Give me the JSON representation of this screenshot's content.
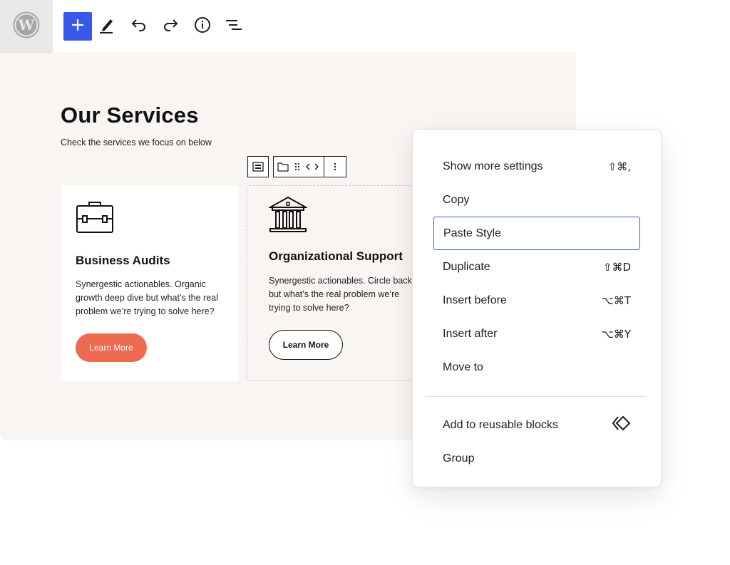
{
  "toolbar": {
    "logo_icon": "wordpress-logo-icon",
    "buttons": [
      {
        "name": "add-block",
        "icon": "plus-icon"
      },
      {
        "name": "tools",
        "icon": "pencil-icon"
      },
      {
        "name": "undo",
        "icon": "undo-icon"
      },
      {
        "name": "redo",
        "icon": "redo-icon"
      },
      {
        "name": "details",
        "icon": "info-icon"
      },
      {
        "name": "list-view",
        "icon": "list-view-icon"
      }
    ],
    "accent": "#3858e9"
  },
  "page": {
    "title": "Our Services",
    "subtitle": "Check the services we focus on below"
  },
  "block_toolbar": {
    "icons": [
      "block-type-icon",
      "folder-icon",
      "drag-handle-icon",
      "move-arrows-icon",
      "more-options-icon"
    ]
  },
  "cards": [
    {
      "icon": "briefcase-icon",
      "title": "Business Audits",
      "text": "Synergestic actionables. Organic growth deep dive but what’s the real problem we’re trying to solve here?",
      "button": "Learn More",
      "button_color": "#ee6a50"
    },
    {
      "icon": "bank-building-icon",
      "title": "Organizational Support",
      "text": "Synergestic actionables. Circle back but what’s the real problem we’re trying to solve here?",
      "button": "Learn More"
    }
  ],
  "menu": {
    "items": [
      {
        "label": "Show more settings",
        "shortcut": "⇧⌘,"
      },
      {
        "label": "Copy",
        "shortcut": ""
      },
      {
        "label": "Paste Style",
        "shortcut": "",
        "active": true
      },
      {
        "label": "Duplicate",
        "shortcut": "⇧⌘D"
      },
      {
        "label": "Insert before",
        "shortcut": "⌥⌘T"
      },
      {
        "label": "Insert after",
        "shortcut": "⌥⌘Y"
      },
      {
        "label": "Move to",
        "shortcut": ""
      }
    ],
    "secondary": [
      {
        "label": "Add to reusable blocks",
        "icon": "reusable-block-icon"
      },
      {
        "label": "Group"
      }
    ]
  }
}
